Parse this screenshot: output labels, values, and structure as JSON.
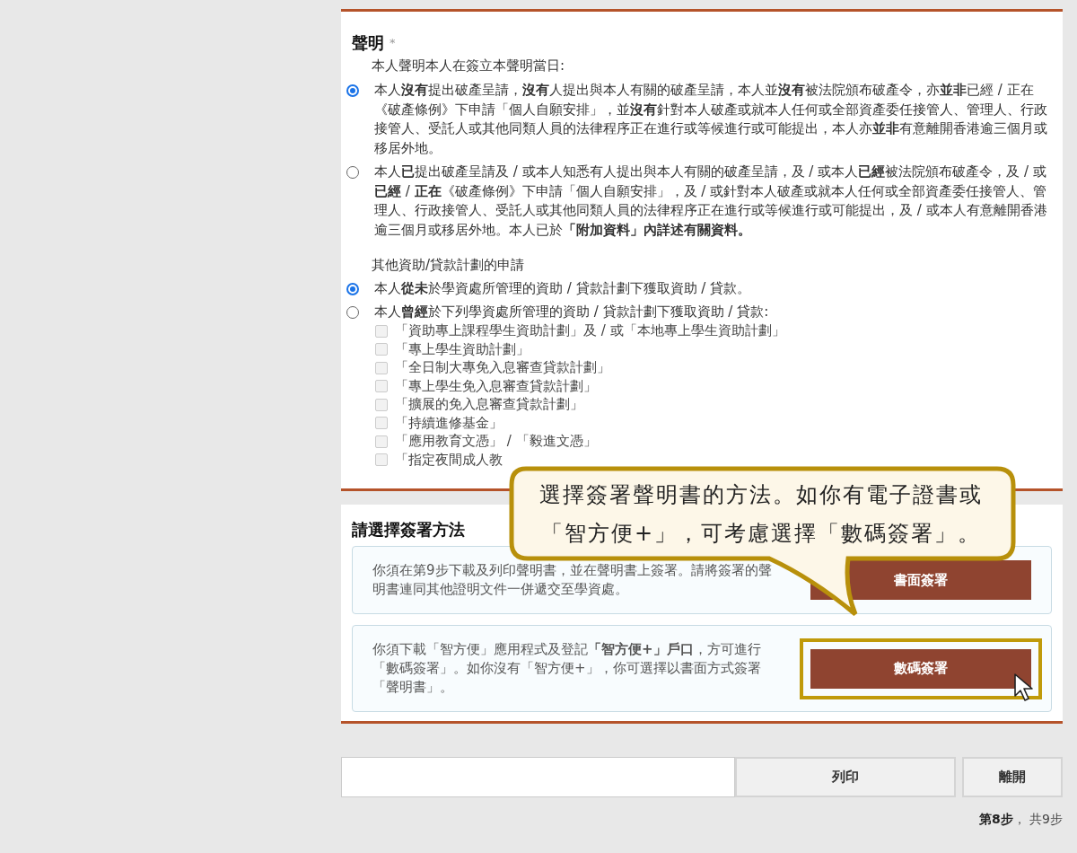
{
  "declaration": {
    "title": "聲明",
    "required_mark": "*",
    "intro": "本人聲明本人在簽立本聲明當日:",
    "options": [
      {
        "text": "本人**沒有**提出破產呈請，**沒有**人提出與本人有關的破產呈請，本人並**沒有**被法院頒布破產令，亦**並非**已經 / 正在《破產條例》下申請「個人自願安排」，並**沒有**針對本人破產或就本人任何或全部資產委任接管人、管理人、行政接管人、受託人或其他同類人員的法律程序正在進行或等候進行或可能提出，本人亦**並非**有意離開香港逾三個月或移居外地。",
        "selected": true
      },
      {
        "text": "本人**已**提出破產呈請及 / 或本人知悉有人提出與本人有關的破產呈請，及 / 或本人**已經**被法院頒布破產令，及 / 或**已經** / **正在**《破產條例》下申請「個人自願安排」，及 / 或針對本人破產或就本人任何或全部資產委任接管人、管理人、行政接管人、受託人或其他同類人員的法律程序正在進行或等候進行或可能提出，及 / 或本人有意離開香港逾三個月或移居外地。本人已於**「附加資料」內詳述有關資料。**",
        "selected": false
      }
    ]
  },
  "other_schemes": {
    "title": "其他資助/貸款計劃的申請",
    "options": [
      {
        "text": "本人**從未**於學資處所管理的資助 / 貸款計劃下獲取資助 / 貸款。",
        "selected": true
      },
      {
        "text": "本人**曾經**於下列學資處所管理的資助 / 貸款計劃下獲取資助 / 貸款:",
        "selected": false,
        "schemes": [
          {
            "label": "「資助專上課程學生資助計劃」及 / 或「本地專上學生資助計劃」",
            "checked": false,
            "disabled": true
          },
          {
            "label": "「專上學生資助計劃」",
            "checked": false,
            "disabled": true
          },
          {
            "label": "「全日制大專免入息審查貸款計劃」",
            "checked": false,
            "disabled": true
          },
          {
            "label": "「專上學生免入息審查貸款計劃」",
            "checked": false,
            "disabled": true
          },
          {
            "label": "「擴展的免入息審查貸款計劃」",
            "checked": false,
            "disabled": true
          },
          {
            "label": "「持續進修基金」",
            "checked": false,
            "disabled": true
          },
          {
            "label": "「應用教育文憑」 / 「毅進文憑」",
            "checked": false,
            "disabled": true
          },
          {
            "label": "「指定夜間成人教",
            "checked": false,
            "disabled": true
          }
        ]
      }
    ]
  },
  "signing": {
    "title": "請選擇簽署方法",
    "methods": [
      {
        "description": "你須在第9步下載及列印聲明書，並在聲明書上簽署。請將簽署的聲明書連同其他證明文件一併遞交至學資處。",
        "button": "書面簽署",
        "highlighted": false
      },
      {
        "description": "你須下載「智方便」應用程式及登記**「智方便+」戶口**，方可進行「數碼簽署」。如你沒有「智方便+」，你可選擇以書面方式簽署「聲明書」。",
        "button": "數碼簽署",
        "highlighted": true
      }
    ]
  },
  "callout": {
    "lines": [
      "選擇簽署聲明書的方法。如你有電子證書或",
      "「智方便+」，可考慮選擇「數碼簽署」。"
    ]
  },
  "footer": {
    "buttons": [
      "列印",
      "離開"
    ],
    "step": "**第8步**， 共9步"
  }
}
